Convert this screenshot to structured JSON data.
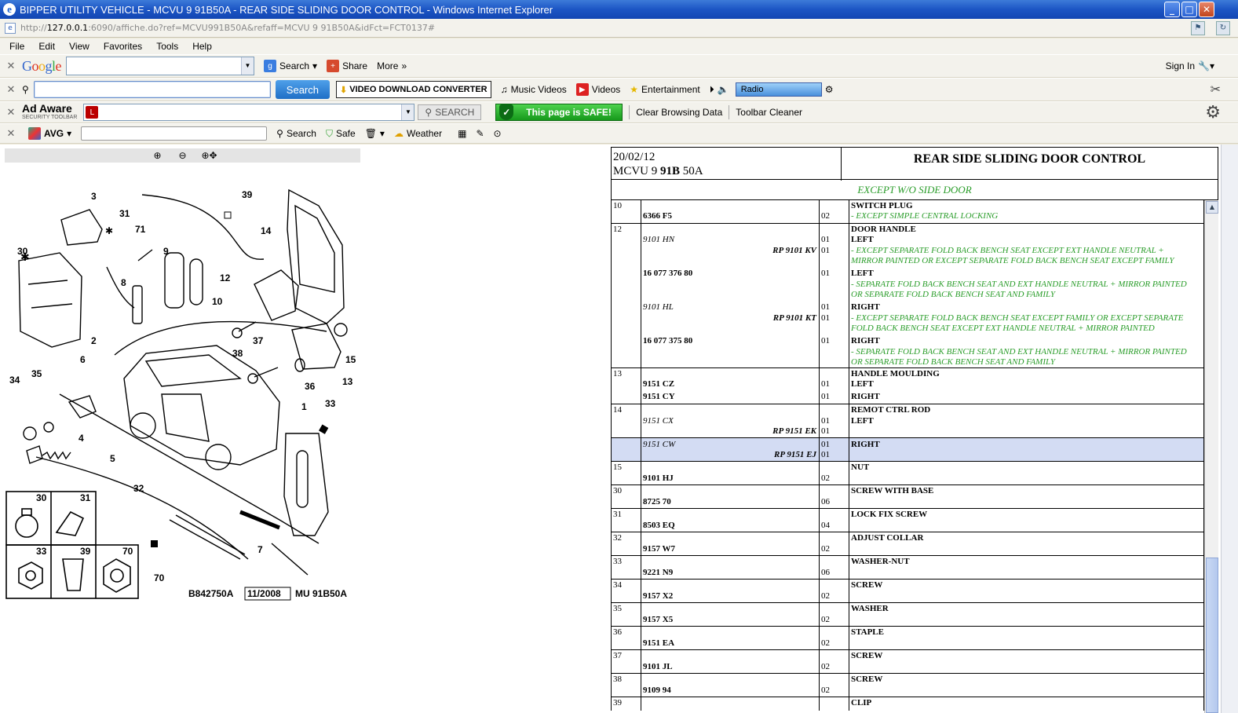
{
  "window": {
    "title": "BIPPER UTILITY VEHICLE - MCVU 9 91B50A - REAR SIDE SLIDING DOOR CONTROL - Windows Internet Explorer",
    "url_host": "127.0.0.1",
    "url_rest": ":6090/affiche.do?ref=MCVU991B50A&refaff=MCVU 9 91B50A&idFct=FCT0137#"
  },
  "menu": [
    "File",
    "Edit",
    "View",
    "Favorites",
    "Tools",
    "Help"
  ],
  "google_toolbar": {
    "logo": "Google",
    "search": "Search",
    "share": "Share",
    "more": "More",
    "signin": "Sign In"
  },
  "search_toolbar": {
    "search_button": "Search",
    "vdc": "VIDEO DOWNLOAD CONVERTER",
    "music": "Music Videos",
    "videos": "Videos",
    "entertainment": "Entertainment",
    "radio": "Radio"
  },
  "adaware_toolbar": {
    "logo": "Ad Aware",
    "sublogo": "SECURITY TOOLBAR",
    "search": "SEARCH",
    "safe": "This page is SAFE!",
    "clear": "Clear Browsing Data",
    "cleaner": "Toolbar Cleaner"
  },
  "avg_toolbar": {
    "logo": "AVG",
    "search": "Search",
    "safe": "Safe",
    "weather": "Weather"
  },
  "diagram": {
    "footer_code": "B842750A",
    "footer_date": "11/2008",
    "footer_ref": "MU 91B50A",
    "callouts": [
      "3",
      "31",
      "39",
      "14",
      "30",
      "71",
      "9",
      "12",
      "10",
      "8",
      "37",
      "2",
      "38",
      "15",
      "6",
      "36",
      "13",
      "34",
      "35",
      "1",
      "33",
      "4",
      "5",
      "32",
      "7",
      "70",
      "30",
      "31",
      "33",
      "39",
      "70"
    ]
  },
  "parts": {
    "date": "20/02/12",
    "model_pre": "MCVU 9 ",
    "model_bold": "91B",
    "model_post": " 50A",
    "title": "REAR SIDE SLIDING DOOR CONTROL",
    "except": "EXCEPT W/O SIDE DOOR",
    "rows": [
      {
        "no": "10",
        "ref": "6366 F5",
        "qty": "02",
        "desc": "SWITCH PLUG",
        "note": "- EXCEPT SIMPLE CENTRAL LOCKING"
      },
      {
        "no": "12",
        "ref": "9101 HN",
        "rp": "RP 9101 KV",
        "qty": "01",
        "qty2": "01",
        "desc": "DOOR HANDLE",
        "side": "LEFT",
        "note": "- EXCEPT SEPARATE FOLD BACK BENCH SEAT EXCEPT EXT HANDLE NEUTRAL + MIRROR PAINTED OR EXCEPT SEPARATE FOLD BACK BENCH SEAT EXCEPT FAMILY",
        "ref_b": "16 077 376 80",
        "qty_b": "01",
        "side_b": "LEFT",
        "note_b": "- SEPARATE FOLD BACK BENCH SEAT AND EXT HANDLE NEUTRAL + MIRROR PAINTED OR SEPARATE FOLD BACK BENCH SEAT AND FAMILY",
        "ref_c": "9101 HL",
        "rp_c": "RP 9101 KT",
        "qty_c": "01",
        "qty_c2": "01",
        "side_c": "RIGHT",
        "note_c": "- EXCEPT SEPARATE FOLD BACK BENCH SEAT EXCEPT FAMILY OR EXCEPT SEPARATE FOLD BACK BENCH SEAT EXCEPT EXT HANDLE NEUTRAL + MIRROR PAINTED",
        "ref_d": "16 077 375 80",
        "qty_d": "01",
        "side_d": "RIGHT",
        "note_d": "- SEPARATE FOLD BACK BENCH SEAT AND EXT HANDLE NEUTRAL + MIRROR PAINTED OR SEPARATE FOLD BACK BENCH SEAT AND FAMILY"
      },
      {
        "no": "13",
        "ref": "9151 CZ",
        "qty": "01",
        "ref2": "9151 CY",
        "qty2": "01",
        "desc": "HANDLE MOULDING",
        "side": "LEFT",
        "side2": "RIGHT"
      },
      {
        "no": "14",
        "ref": "9151 CX",
        "rp": "RP 9151 EK",
        "qty": "01",
        "qty2": "01",
        "desc": "REMOT CTRL ROD",
        "side": "LEFT"
      },
      {
        "ref": "9151 CW",
        "rp": "RP 9151 EJ",
        "qty": "01",
        "qty2": "01",
        "side": "RIGHT"
      },
      {
        "no": "15",
        "ref": "9101 HJ",
        "qty": "02",
        "desc": "NUT"
      },
      {
        "no": "30",
        "ref": "8725 70",
        "qty": "06",
        "desc": "SCREW WITH BASE"
      },
      {
        "no": "31",
        "ref": "8503 EQ",
        "qty": "04",
        "desc": "LOCK FIX SCREW"
      },
      {
        "no": "32",
        "ref": "9157 W7",
        "qty": "02",
        "desc": "ADJUST COLLAR"
      },
      {
        "no": "33",
        "ref": "9221 N9",
        "qty": "06",
        "desc": "WASHER-NUT"
      },
      {
        "no": "34",
        "ref": "9157 X2",
        "qty": "02",
        "desc": "SCREW"
      },
      {
        "no": "35",
        "ref": "9157 X5",
        "qty": "02",
        "desc": "WASHER"
      },
      {
        "no": "36",
        "ref": "9151 EA",
        "qty": "02",
        "desc": "STAPLE"
      },
      {
        "no": "37",
        "ref": "9101 JL",
        "qty": "02",
        "desc": "SCREW"
      },
      {
        "no": "38",
        "ref": "9109 94",
        "qty": "02",
        "desc": "SCREW"
      },
      {
        "no": "39",
        "desc": "CLIP"
      }
    ]
  }
}
